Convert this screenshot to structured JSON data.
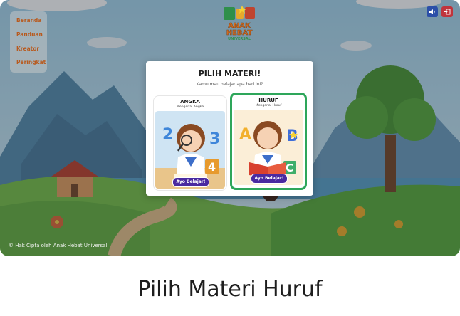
{
  "nav": {
    "items": [
      {
        "label": "Beranda"
      },
      {
        "label": "Panduan"
      },
      {
        "label": "Kreator"
      },
      {
        "label": "Peringkat"
      }
    ]
  },
  "logo": {
    "line1": "ANAK",
    "line2": "HEBAT",
    "line3": "UNIVERSAL"
  },
  "header_buttons": {
    "sound_icon": "speaker-icon",
    "logout_icon": "logout-icon"
  },
  "modal": {
    "title": "PILIH MATERI!",
    "subtitle": "Kamu mau belajar apa hari ini?",
    "cards": [
      {
        "title": "ANGKA",
        "subtitle": "Mengenal Angka",
        "button": "Ayo Belajar!",
        "selected": false
      },
      {
        "title": "HURUF",
        "subtitle": "Mengenal Huruf",
        "button": "Ayo Belajar!",
        "selected": true
      }
    ]
  },
  "footer": {
    "copyright": "© Hak Cipta oleh Anak Hebat Universal"
  },
  "caption": "Pilih Materi Huruf",
  "colors": {
    "accent_purple": "#4a2aa0",
    "selected_border": "#2ea65a",
    "nav_text": "#b85a1e",
    "logout_red": "#c0343c",
    "sound_blue": "#2c4fa8"
  }
}
